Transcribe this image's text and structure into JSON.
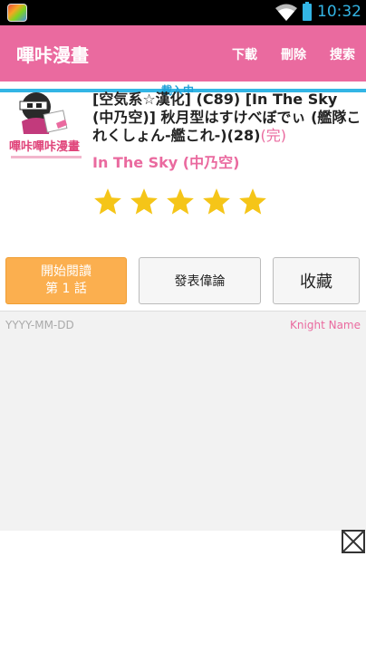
{
  "status_bar": {
    "time": "10:32"
  },
  "action_bar": {
    "title": "嗶咔漫畫",
    "download": "下載",
    "delete": "刪除",
    "search": "搜索"
  },
  "loading": {
    "label": "載入中"
  },
  "comic": {
    "title": "[空気系☆漢化] (C89) [In The Sky (中乃空)] 秋月型はすけべぼでぃ (艦隊これくしょん-艦これ-)(28)",
    "status": "(完)",
    "author": "In The Sky (中乃空)",
    "rating": 5,
    "rating_max": 5,
    "star_color": "#f5c518"
  },
  "actions": {
    "read_line1": "開始閱讀",
    "read_line2": "第 1 話",
    "comment": "發表偉論",
    "favorite": "收藏"
  },
  "comment": {
    "date": "YYYY-MM-DD",
    "name": "Knight Name"
  },
  "colors": {
    "brand_pink": "#ea6a9f",
    "accent_orange": "#fbaf4f",
    "loading_blue": "#33b5e5"
  }
}
